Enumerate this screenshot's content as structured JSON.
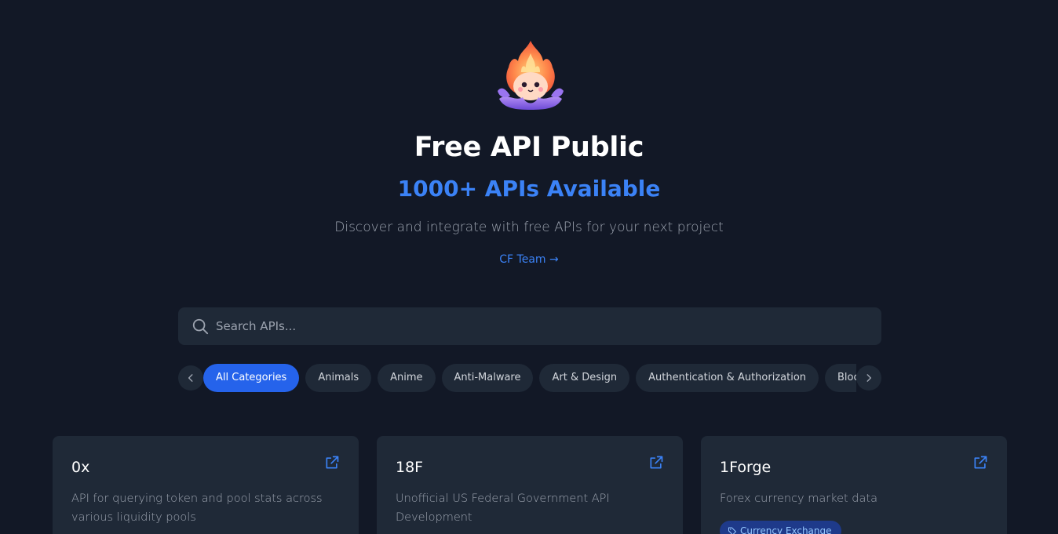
{
  "header": {
    "title": "Free API Public",
    "subtitle": "1000+ APIs Available",
    "tagline": "Discover and integrate with free APIs for your next project",
    "team_link": "CF Team →"
  },
  "search": {
    "placeholder": "Search APIs..."
  },
  "categories": [
    {
      "label": "All Categories",
      "active": true
    },
    {
      "label": "Animals"
    },
    {
      "label": "Anime"
    },
    {
      "label": "Anti-Malware"
    },
    {
      "label": "Art & Design"
    },
    {
      "label": "Authentication & Authorization"
    },
    {
      "label": "Blockchain"
    }
  ],
  "cards": [
    {
      "name": "0x",
      "description": "API for querying token and pool stats across various liquidity pools"
    },
    {
      "name": "18F",
      "description": "Unofficial US Federal Government API Development"
    },
    {
      "name": "1Forge",
      "description": "Forex currency market data",
      "tag": "Currency Exchange"
    }
  ],
  "colors": {
    "background": "#121826",
    "surface": "#1f2937",
    "accent": "#3b82f6",
    "chip_active": "#2563eb"
  },
  "icons": {
    "logo": "flame-mascot-logo",
    "search": "search-icon",
    "external": "external-link-icon",
    "prev": "chevron-left-icon",
    "next": "chevron-right-icon",
    "tag": "tag-icon"
  }
}
